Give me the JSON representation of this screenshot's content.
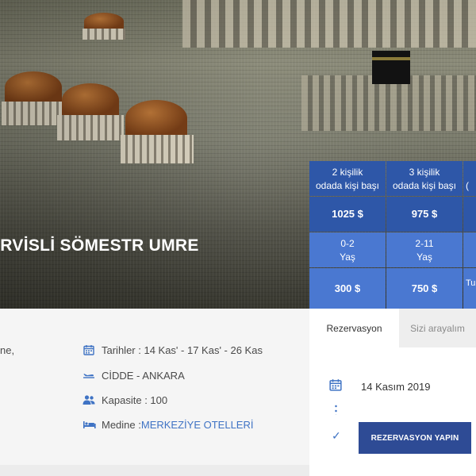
{
  "hero": {
    "title": "ERVİSLİ SÖMESTR UMRE"
  },
  "price_table": {
    "headers": [
      {
        "line1": "2 kişilik",
        "line2": "odada kişi başı"
      },
      {
        "line1": "3 kişilik",
        "line2": "odada kişi başı"
      },
      {
        "line1": "",
        "line2": "("
      }
    ],
    "adult_prices": [
      "1025 $",
      "975 $",
      ""
    ],
    "age_groups": [
      {
        "line1": "0-2",
        "line2": "Yaş"
      },
      {
        "line1": "2-11",
        "line2": "Yaş"
      },
      {
        "line1": "",
        "line2": ""
      }
    ],
    "child_prices": [
      "300 $",
      "750 $",
      "Tu"
    ]
  },
  "info": {
    "fragment": "ne,",
    "dates_label": "Tarihler : 14 Kas' - 17 Kas' - 26 Kas",
    "flight_label": "CİDDE - ANKARA",
    "capacity_label": "Kapasite : 100",
    "hotel_prefix": "Medine : ",
    "hotel_link": "MERKEZİYE OTELLERİ"
  },
  "booking": {
    "tab_reservation": "Rezervasyon",
    "tab_callback": "Sizi arayalım",
    "date": "14 Kasım 2019",
    "button_label": "REZERVASYON YAPIN"
  },
  "colors": {
    "accent": "#3f73c4",
    "table_dark": "#2e57a8",
    "table_light": "#4a78d1",
    "button": "#2e4b95"
  },
  "icons": [
    "calendar-icon",
    "plane-icon",
    "users-icon",
    "bed-icon",
    "check-icon"
  ]
}
